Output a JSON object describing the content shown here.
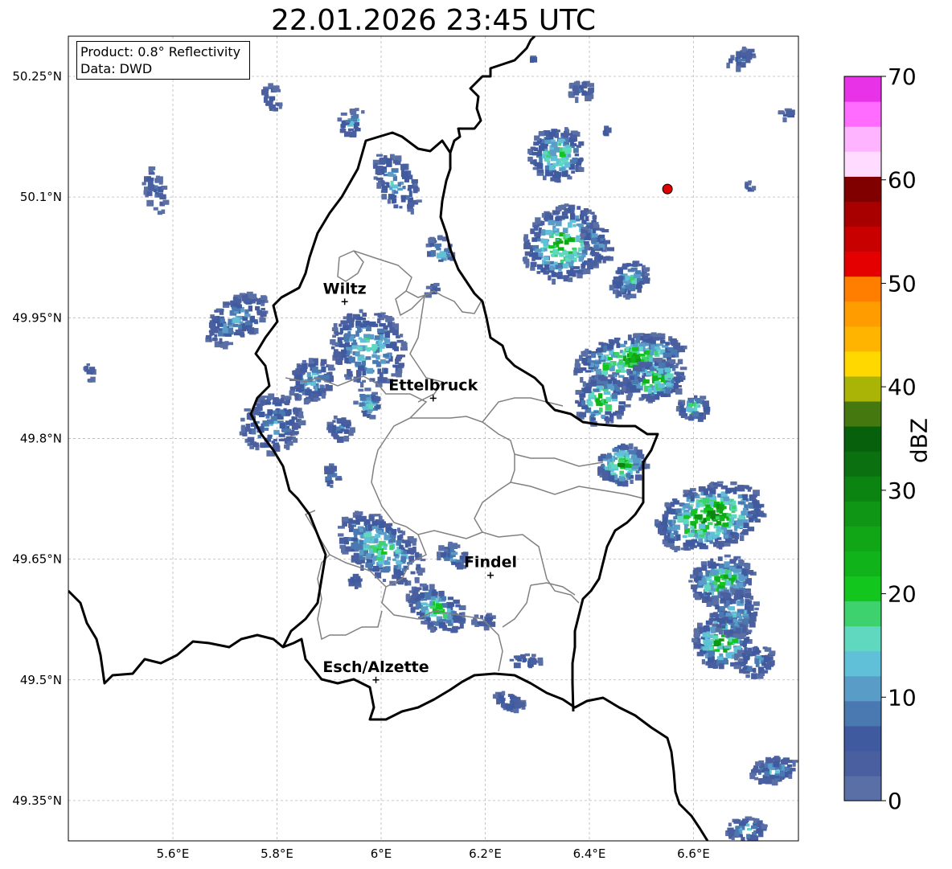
{
  "title": "22.01.2026 23:45 UTC",
  "info_box": {
    "product": "Product: 0.8° Reflectivity",
    "source": "Data: DWD"
  },
  "axes": {
    "x_ticks": [
      "5.6°E",
      "5.8°E",
      "6°E",
      "6.2°E",
      "6.4°E",
      "6.6°E"
    ],
    "y_ticks": [
      "50.25°N",
      "50.1°N",
      "49.95°N",
      "49.8°N",
      "49.65°N",
      "49.5°N",
      "49.35°N"
    ],
    "gridlines": true
  },
  "places": [
    {
      "name": "Wiltz",
      "lon": 5.93,
      "lat": 49.97
    },
    {
      "name": "Ettelbruck",
      "lon": 6.1,
      "lat": 49.85
    },
    {
      "name": "Findel",
      "lon": 6.21,
      "lat": 49.63
    },
    {
      "name": "Esch/Alzette",
      "lon": 5.99,
      "lat": 49.5
    }
  ],
  "marker": {
    "lon": 6.55,
    "lat": 50.11,
    "color": "#e00000"
  },
  "colorbar": {
    "unit": "dBZ",
    "ticks": [
      "0",
      "10",
      "20",
      "30",
      "40",
      "50",
      "60",
      "70"
    ],
    "colors": [
      "#5a6fa5",
      "#4a5fa0",
      "#405aa0",
      "#4a78b0",
      "#5a9cc8",
      "#60c0d8",
      "#60d8c0",
      "#3ed26e",
      "#12c61e",
      "#10b41a",
      "#10a616",
      "#0e9614",
      "#0c8412",
      "#0a7010",
      "#06600c",
      "#467810",
      "#aab406",
      "#ffd800",
      "#ffb400",
      "#ff9c00",
      "#ff7e00",
      "#e40000",
      "#c80000",
      "#a80000",
      "#800000",
      "#ffdcff",
      "#ffb4ff",
      "#ff6cff",
      "#e832e8"
    ]
  }
}
